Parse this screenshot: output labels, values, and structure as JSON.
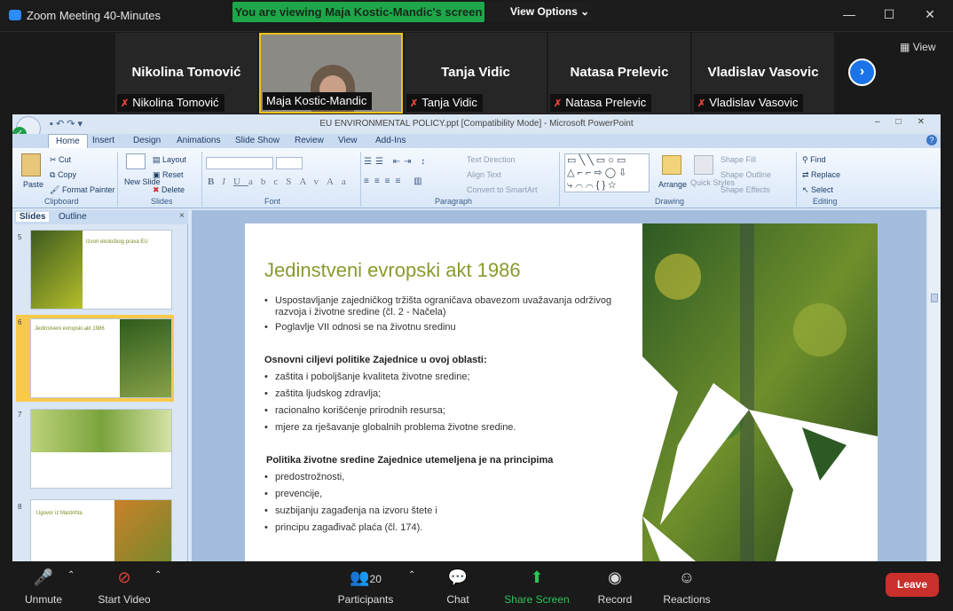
{
  "window": {
    "title": "Zoom Meeting 40-Minutes",
    "banner": "You are viewing Maja Kostic-Mandic's screen",
    "view_options": "View Options",
    "minimize": "—",
    "maximize": "☐",
    "close": "✕"
  },
  "strip": {
    "view_label": "View",
    "next": "›",
    "participants": [
      {
        "big_name": "Nikolina Tomović",
        "label": "Nikolina Tomović"
      },
      {
        "big_name": "",
        "label": "Maja Kostic-Mandic"
      },
      {
        "big_name": "Tanja Vidic",
        "label": "Tanja Vidic"
      },
      {
        "big_name": "Natasa Prelevic",
        "label": "Natasa Prelevic"
      },
      {
        "big_name": "Vladislav Vasovic",
        "label": "Vladislav Vasovic"
      }
    ]
  },
  "ppt": {
    "title": "EU ENVIRONMENTAL POLICY.ppt [Compatibility Mode] - Microsoft PowerPoint",
    "tabs": [
      "Home",
      "Insert",
      "Design",
      "Animations",
      "Slide Show",
      "Review",
      "View",
      "Add-Ins"
    ],
    "clipboard": {
      "paste": "Paste",
      "cut": "Cut",
      "copy": "Copy",
      "format_painter": "Format Painter",
      "label": "Clipboard"
    },
    "slides_group": {
      "new_slide": "New Slide",
      "layout": "Layout",
      "reset": "Reset",
      "delete": "Delete",
      "label": "Slides"
    },
    "font_label": "Font",
    "paragraph": {
      "text_direction": "Text Direction",
      "align_text": "Align Text",
      "convert": "Convert to SmartArt",
      "label": "Paragraph"
    },
    "drawing": {
      "arrange": "Arrange",
      "quick_styles": "Quick Styles",
      "shape_fill": "Shape Fill",
      "shape_outline": "Shape Outline",
      "shape_effects": "Shape Effects",
      "label": "Drawing"
    },
    "editing": {
      "find": "Find",
      "replace": "Replace",
      "select": "Select",
      "label": "Editing"
    },
    "panel_tabs": [
      "Slides",
      "Outline"
    ],
    "thumb_numbers": [
      "5",
      "6",
      "7",
      "8"
    ],
    "thumbs": {
      "t5": "Izvori ekološkog prava EU",
      "t6": "Jedinstveni evropski akt 1986",
      "t8": "Ugovor iz Mastrihta"
    }
  },
  "slide": {
    "title": "Jedinstveni evropski akt 1986",
    "bullets1": [
      "Uspostavljanje zajedničkog tržišta ograničava obavezom uvažavanja održivog razvoja i životne sredine (čl. 2 - Načela)",
      "Poglavlje VII odnosi se na životnu sredinu"
    ],
    "heading2": "Osnovni ciljevi politike Zajednice u ovoj oblasti:",
    "bullets2": [
      "zaštita i poboljšanje kvaliteta životne sredine;",
      "zaštita ljudskog zdravlja;",
      "racionalno korišćenje prirodnih resursa;",
      "mjere za rješavanje globalnih problema životne sredine."
    ],
    "heading3": "Politika životne sredine Zajednice utemeljena je na principima",
    "bullets3": [
      "predostrožnosti,",
      "prevencije,",
      "suzbijanju zagađenja na izvoru štete i",
      "principu zagađivač plaća (čl. 174)."
    ]
  },
  "toolbar": {
    "unmute": "Unmute",
    "start_video": "Start Video",
    "participants": "Participants",
    "participants_count": "20",
    "chat": "Chat",
    "share_screen": "Share Screen",
    "record": "Record",
    "reactions": "Reactions",
    "leave": "Leave"
  },
  "colors": {
    "banner": "#1ea74a",
    "leave": "#c9302c",
    "title_green": "#8a9a2e",
    "next_arrow": "#1a73e8"
  }
}
